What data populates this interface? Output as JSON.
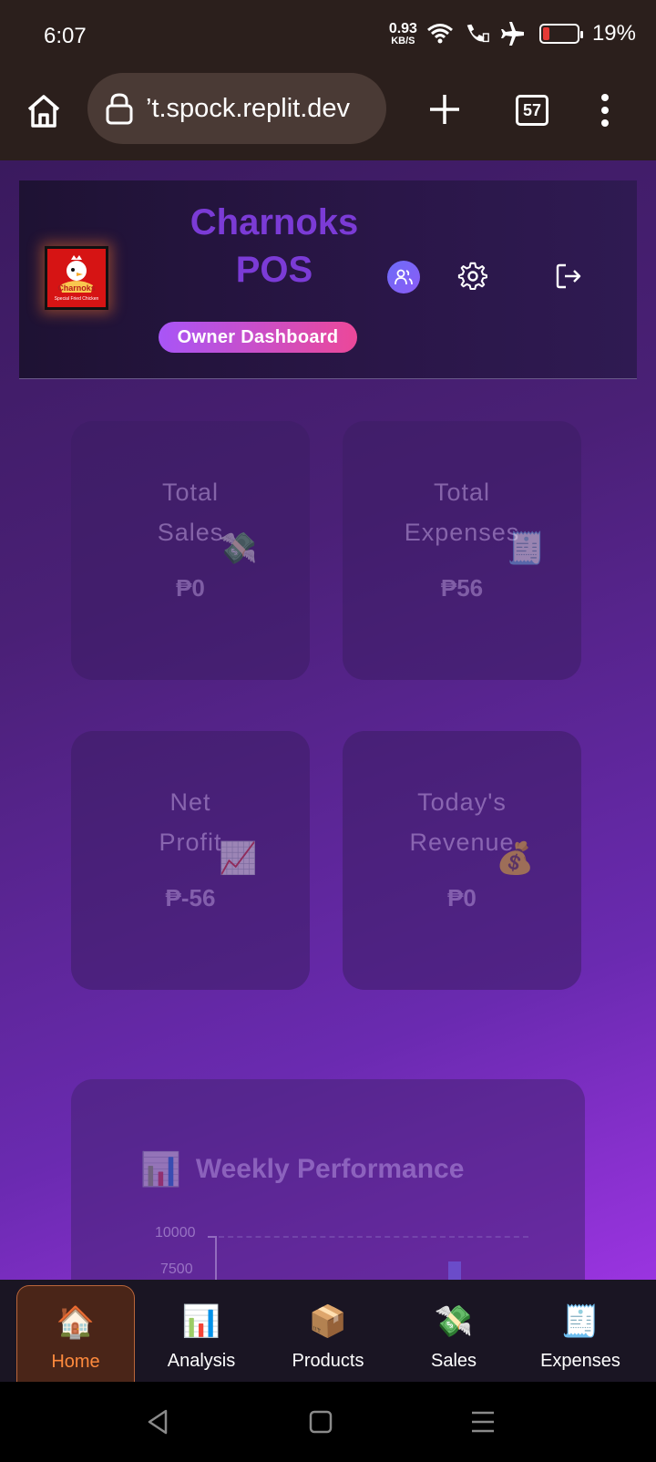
{
  "status_bar": {
    "time": "6:07",
    "net_speed_value": "0.93",
    "net_speed_unit": "KB/S",
    "battery_percent": "19%",
    "battery_level": 0.19,
    "battery_color": "#e53935"
  },
  "browser": {
    "url": "’t.spock.replit.dev",
    "tab_count": "57"
  },
  "header": {
    "title_line1": "Charnoks",
    "title_line2": "POS",
    "badge": "Owner Dashboard",
    "logo_text": "Charnoks",
    "logo_subtext": "Special Fried Chicken"
  },
  "stats": [
    {
      "label_line1": "Total",
      "label_line2": "Sales",
      "value": "₱0",
      "emoji": "💸"
    },
    {
      "label_line1": "Total",
      "label_line2": "Expenses",
      "value": "₱56",
      "emoji": "🧾"
    },
    {
      "label_line1": "Net",
      "label_line2": "Profit",
      "value": "₱-56",
      "emoji": "📈"
    },
    {
      "label_line1": "Today's",
      "label_line2": "Revenue",
      "value": "₱0",
      "emoji": "💰"
    }
  ],
  "performance": {
    "emoji": "📊",
    "title": "Weekly Performance",
    "y_tick_top": "10000",
    "y_tick_next": "7500"
  },
  "bottom_nav": [
    {
      "label": "Home",
      "emoji": "🏠",
      "active": true
    },
    {
      "label": "Analysis",
      "emoji": "📊",
      "active": false
    },
    {
      "label": "Products",
      "emoji": "📦",
      "active": false
    },
    {
      "label": "Sales",
      "emoji": "💸",
      "active": false
    },
    {
      "label": "Expenses",
      "emoji": "🧾",
      "active": false
    }
  ],
  "colors": {
    "brand_purple": "#7b3bd6",
    "active_nav": "#ff8a3d",
    "badge_start": "#a855f7",
    "badge_end": "#ec4899"
  }
}
